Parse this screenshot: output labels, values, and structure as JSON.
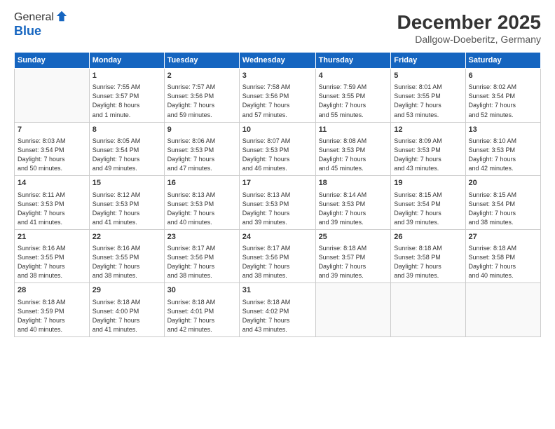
{
  "logo": {
    "general": "General",
    "blue": "Blue"
  },
  "header": {
    "month": "December 2025",
    "location": "Dallgow-Doeberitz, Germany"
  },
  "weekdays": [
    "Sunday",
    "Monday",
    "Tuesday",
    "Wednesday",
    "Thursday",
    "Friday",
    "Saturday"
  ],
  "weeks": [
    [
      {
        "day": "",
        "info": ""
      },
      {
        "day": "1",
        "info": "Sunrise: 7:55 AM\nSunset: 3:57 PM\nDaylight: 8 hours\nand 1 minute."
      },
      {
        "day": "2",
        "info": "Sunrise: 7:57 AM\nSunset: 3:56 PM\nDaylight: 7 hours\nand 59 minutes."
      },
      {
        "day": "3",
        "info": "Sunrise: 7:58 AM\nSunset: 3:56 PM\nDaylight: 7 hours\nand 57 minutes."
      },
      {
        "day": "4",
        "info": "Sunrise: 7:59 AM\nSunset: 3:55 PM\nDaylight: 7 hours\nand 55 minutes."
      },
      {
        "day": "5",
        "info": "Sunrise: 8:01 AM\nSunset: 3:55 PM\nDaylight: 7 hours\nand 53 minutes."
      },
      {
        "day": "6",
        "info": "Sunrise: 8:02 AM\nSunset: 3:54 PM\nDaylight: 7 hours\nand 52 minutes."
      }
    ],
    [
      {
        "day": "7",
        "info": "Sunrise: 8:03 AM\nSunset: 3:54 PM\nDaylight: 7 hours\nand 50 minutes."
      },
      {
        "day": "8",
        "info": "Sunrise: 8:05 AM\nSunset: 3:54 PM\nDaylight: 7 hours\nand 49 minutes."
      },
      {
        "day": "9",
        "info": "Sunrise: 8:06 AM\nSunset: 3:53 PM\nDaylight: 7 hours\nand 47 minutes."
      },
      {
        "day": "10",
        "info": "Sunrise: 8:07 AM\nSunset: 3:53 PM\nDaylight: 7 hours\nand 46 minutes."
      },
      {
        "day": "11",
        "info": "Sunrise: 8:08 AM\nSunset: 3:53 PM\nDaylight: 7 hours\nand 45 minutes."
      },
      {
        "day": "12",
        "info": "Sunrise: 8:09 AM\nSunset: 3:53 PM\nDaylight: 7 hours\nand 43 minutes."
      },
      {
        "day": "13",
        "info": "Sunrise: 8:10 AM\nSunset: 3:53 PM\nDaylight: 7 hours\nand 42 minutes."
      }
    ],
    [
      {
        "day": "14",
        "info": "Sunrise: 8:11 AM\nSunset: 3:53 PM\nDaylight: 7 hours\nand 41 minutes."
      },
      {
        "day": "15",
        "info": "Sunrise: 8:12 AM\nSunset: 3:53 PM\nDaylight: 7 hours\nand 41 minutes."
      },
      {
        "day": "16",
        "info": "Sunrise: 8:13 AM\nSunset: 3:53 PM\nDaylight: 7 hours\nand 40 minutes."
      },
      {
        "day": "17",
        "info": "Sunrise: 8:13 AM\nSunset: 3:53 PM\nDaylight: 7 hours\nand 39 minutes."
      },
      {
        "day": "18",
        "info": "Sunrise: 8:14 AM\nSunset: 3:53 PM\nDaylight: 7 hours\nand 39 minutes."
      },
      {
        "day": "19",
        "info": "Sunrise: 8:15 AM\nSunset: 3:54 PM\nDaylight: 7 hours\nand 39 minutes."
      },
      {
        "day": "20",
        "info": "Sunrise: 8:15 AM\nSunset: 3:54 PM\nDaylight: 7 hours\nand 38 minutes."
      }
    ],
    [
      {
        "day": "21",
        "info": "Sunrise: 8:16 AM\nSunset: 3:55 PM\nDaylight: 7 hours\nand 38 minutes."
      },
      {
        "day": "22",
        "info": "Sunrise: 8:16 AM\nSunset: 3:55 PM\nDaylight: 7 hours\nand 38 minutes."
      },
      {
        "day": "23",
        "info": "Sunrise: 8:17 AM\nSunset: 3:56 PM\nDaylight: 7 hours\nand 38 minutes."
      },
      {
        "day": "24",
        "info": "Sunrise: 8:17 AM\nSunset: 3:56 PM\nDaylight: 7 hours\nand 38 minutes."
      },
      {
        "day": "25",
        "info": "Sunrise: 8:18 AM\nSunset: 3:57 PM\nDaylight: 7 hours\nand 39 minutes."
      },
      {
        "day": "26",
        "info": "Sunrise: 8:18 AM\nSunset: 3:58 PM\nDaylight: 7 hours\nand 39 minutes."
      },
      {
        "day": "27",
        "info": "Sunrise: 8:18 AM\nSunset: 3:58 PM\nDaylight: 7 hours\nand 40 minutes."
      }
    ],
    [
      {
        "day": "28",
        "info": "Sunrise: 8:18 AM\nSunset: 3:59 PM\nDaylight: 7 hours\nand 40 minutes."
      },
      {
        "day": "29",
        "info": "Sunrise: 8:18 AM\nSunset: 4:00 PM\nDaylight: 7 hours\nand 41 minutes."
      },
      {
        "day": "30",
        "info": "Sunrise: 8:18 AM\nSunset: 4:01 PM\nDaylight: 7 hours\nand 42 minutes."
      },
      {
        "day": "31",
        "info": "Sunrise: 8:18 AM\nSunset: 4:02 PM\nDaylight: 7 hours\nand 43 minutes."
      },
      {
        "day": "",
        "info": ""
      },
      {
        "day": "",
        "info": ""
      },
      {
        "day": "",
        "info": ""
      }
    ]
  ]
}
